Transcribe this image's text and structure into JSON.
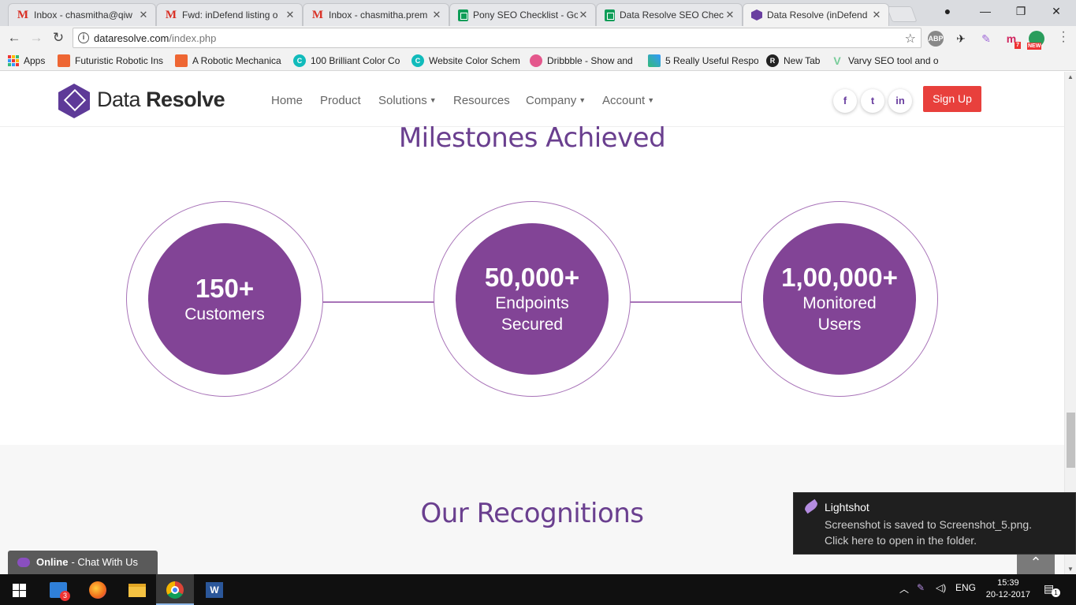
{
  "browser": {
    "tabs": [
      {
        "title": "Inbox - chasmitha@qiw",
        "icon": "gmail-icon"
      },
      {
        "title": "Fwd: inDefend listing o",
        "icon": "gmail-icon"
      },
      {
        "title": "Inbox - chasmitha.prem",
        "icon": "gmail-icon"
      },
      {
        "title": "Pony SEO Checklist - Go",
        "icon": "sheets-icon"
      },
      {
        "title": "Data Resolve SEO Chec",
        "icon": "sheets-icon"
      },
      {
        "title": "Data Resolve (inDefend",
        "icon": "data-resolve-icon"
      }
    ],
    "url_host": "dataresolve.com",
    "url_path": "/index.php",
    "extensions": [
      "ABP",
      "7",
      "NEW"
    ],
    "bookmarks": [
      {
        "label": "Apps"
      },
      {
        "label": "Futuristic Robotic Ins"
      },
      {
        "label": "A Robotic Mechanica"
      },
      {
        "label": "100 Brilliant Color Co"
      },
      {
        "label": "Website Color Schem"
      },
      {
        "label": "Dribbble - Show and"
      },
      {
        "label": "5 Really Useful Respo"
      },
      {
        "label": "New Tab"
      },
      {
        "label": "Varvy SEO tool and o"
      }
    ]
  },
  "site": {
    "logo_light": "Data",
    "logo_bold": "Resolve",
    "nav": [
      {
        "label": "Home"
      },
      {
        "label": "Product"
      },
      {
        "label": "Solutions"
      },
      {
        "label": "Resources"
      },
      {
        "label": "Company"
      },
      {
        "label": "Account"
      }
    ],
    "social": [
      "f",
      "t",
      "in"
    ],
    "signup_label": "Sign Up",
    "milestones_title": "Milestones Achieved",
    "milestones": [
      {
        "number": "150+",
        "label_line1": "Customers",
        "label_line2": ""
      },
      {
        "number": "50,000+",
        "label_line1": "Endpoints",
        "label_line2": "Secured"
      },
      {
        "number": "1,00,000+",
        "label_line1": "Monitored",
        "label_line2": "Users"
      }
    ],
    "recognitions_title": "Our Recognitions",
    "chat_status": "Online",
    "chat_label": "- Chat With Us"
  },
  "notification": {
    "app": "Lightshot",
    "line1": "Screenshot is saved to Screenshot_5.png.",
    "line2": "Click here to open in the folder."
  },
  "taskbar": {
    "badge": "3",
    "lang": "ENG",
    "time": "15:39",
    "date": "20-12-2017",
    "notif_count": "1"
  },
  "colors": {
    "brand_purple": "#824496",
    "signup_red": "#e8403c"
  }
}
